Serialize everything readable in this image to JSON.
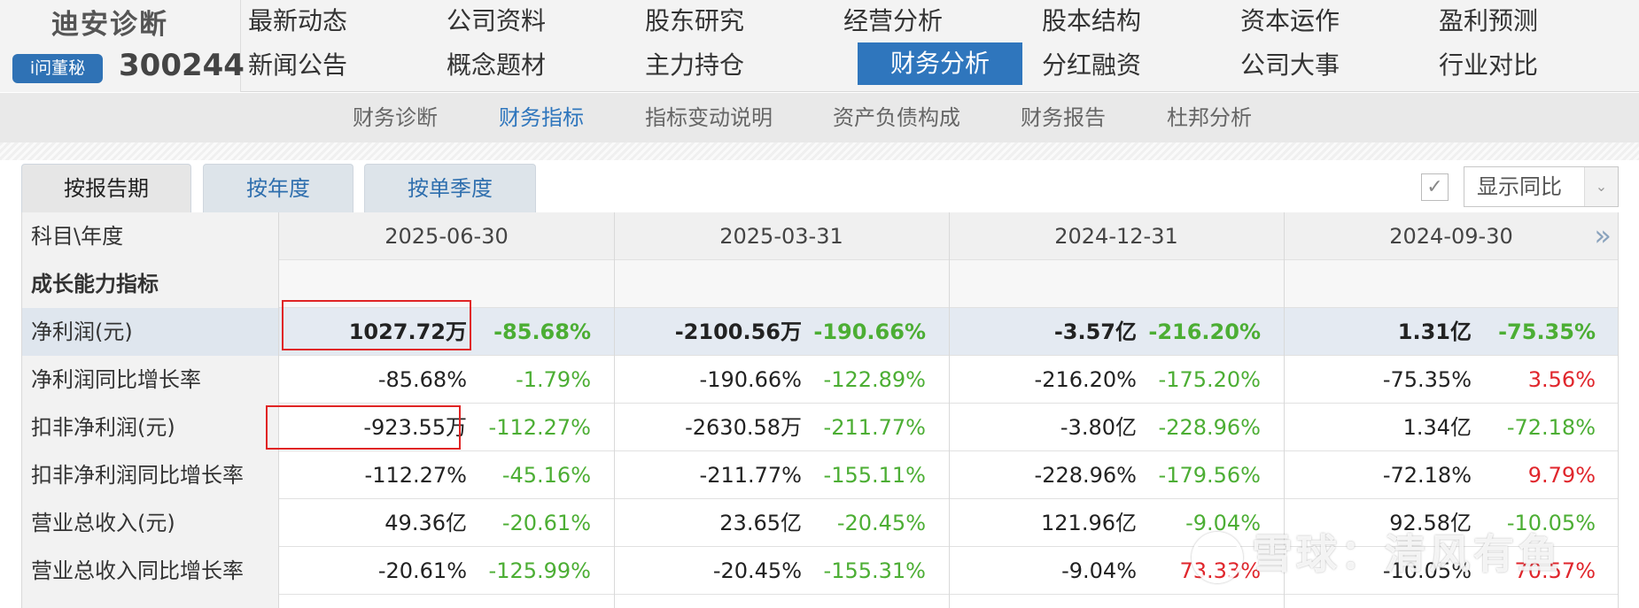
{
  "company": {
    "name": "迪安诊断",
    "ask_badge": "i问董秘",
    "code": "300244"
  },
  "nav": {
    "row1": [
      "最新动态",
      "公司资料",
      "股东研究",
      "经营分析",
      "股本结构",
      "资本运作",
      "盈利预测"
    ],
    "row2": [
      "新闻公告",
      "概念题材",
      "主力持仓",
      "财务分析",
      "分红融资",
      "公司大事",
      "行业对比"
    ],
    "active": "财务分析"
  },
  "subnav": {
    "items": [
      "财务诊断",
      "财务指标",
      "指标变动说明",
      "资产负债构成",
      "财务报告",
      "杜邦分析"
    ],
    "active": "财务指标"
  },
  "period_tabs": {
    "items": [
      "按报告期",
      "按年度",
      "按单季度"
    ],
    "active": "按报告期"
  },
  "yoy_toggle": {
    "checked": true,
    "check_glyph": "✓",
    "label": "显示同比",
    "arrow": "⌄"
  },
  "table": {
    "header_label": "科目\\年度",
    "dates": [
      "2025-06-30",
      "2025-03-31",
      "2024-12-31",
      "2024-09-30"
    ],
    "more_glyph": "»",
    "section_title": "成长能力指标",
    "rows": [
      {
        "label": "净利润(元)",
        "cells": [
          {
            "value": "1027.72万",
            "yoy": "-85.68%",
            "yoy_color": "green"
          },
          {
            "value": "-2100.56万",
            "yoy": "-190.66%",
            "yoy_color": "green"
          },
          {
            "value": "-3.57亿",
            "yoy": "-216.20%",
            "yoy_color": "green"
          },
          {
            "value": "1.31亿",
            "yoy": "-75.35%",
            "yoy_color": "green"
          }
        ]
      },
      {
        "label": "净利润同比增长率",
        "cells": [
          {
            "value": "-85.68%",
            "yoy": "-1.79%",
            "yoy_color": "green"
          },
          {
            "value": "-190.66%",
            "yoy": "-122.89%",
            "yoy_color": "green"
          },
          {
            "value": "-216.20%",
            "yoy": "-175.20%",
            "yoy_color": "green"
          },
          {
            "value": "-75.35%",
            "yoy": "3.56%",
            "yoy_color": "red"
          }
        ]
      },
      {
        "label": "扣非净利润(元)",
        "cells": [
          {
            "value": "-923.55万",
            "yoy": "-112.27%",
            "yoy_color": "green"
          },
          {
            "value": "-2630.58万",
            "yoy": "-211.77%",
            "yoy_color": "green"
          },
          {
            "value": "-3.80亿",
            "yoy": "-228.96%",
            "yoy_color": "green"
          },
          {
            "value": "1.34亿",
            "yoy": "-72.18%",
            "yoy_color": "green"
          }
        ]
      },
      {
        "label": "扣非净利润同比增长率",
        "cells": [
          {
            "value": "-112.27%",
            "yoy": "-45.16%",
            "yoy_color": "green"
          },
          {
            "value": "-211.77%",
            "yoy": "-155.11%",
            "yoy_color": "green"
          },
          {
            "value": "-228.96%",
            "yoy": "-179.56%",
            "yoy_color": "green"
          },
          {
            "value": "-72.18%",
            "yoy": "9.79%",
            "yoy_color": "red"
          }
        ]
      },
      {
        "label": "营业总收入(元)",
        "cells": [
          {
            "value": "49.36亿",
            "yoy": "-20.61%",
            "yoy_color": "green"
          },
          {
            "value": "23.65亿",
            "yoy": "-20.45%",
            "yoy_color": "green"
          },
          {
            "value": "121.96亿",
            "yoy": "-9.04%",
            "yoy_color": "green"
          },
          {
            "value": "92.58亿",
            "yoy": "-10.05%",
            "yoy_color": "green"
          }
        ]
      },
      {
        "label": "营业总收入同比增长率",
        "cells": [
          {
            "value": "-20.61%",
            "yoy": "-125.99%",
            "yoy_color": "green"
          },
          {
            "value": "-20.45%",
            "yoy": "-155.31%",
            "yoy_color": "green"
          },
          {
            "value": "-9.04%",
            "yoy": "73.33%",
            "yoy_color": "red"
          },
          {
            "value": "-10.05%",
            "yoy": "70.57%",
            "yoy_color": "red"
          }
        ]
      }
    ]
  },
  "watermark": {
    "text": "雪球：清风有鱼"
  },
  "colors": {
    "accent": "#2f76bd",
    "positive": "#e0262c",
    "negative": "#4cae34",
    "highlight_box": "#e02424"
  }
}
